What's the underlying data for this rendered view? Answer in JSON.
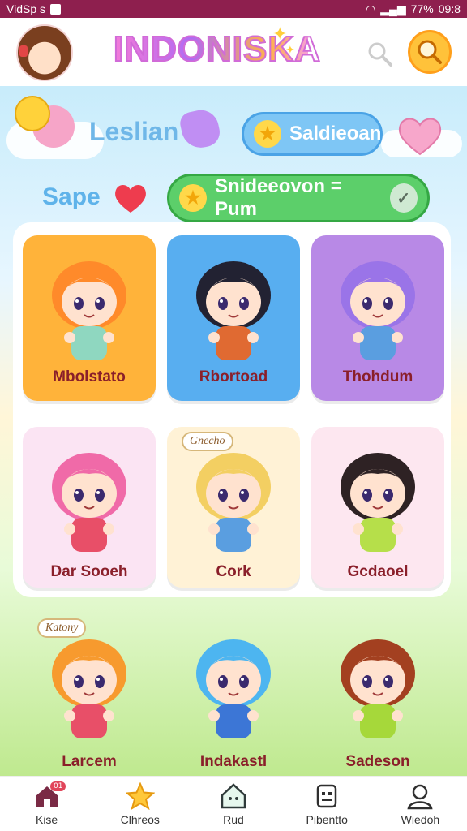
{
  "status_bar": {
    "left_text": "VidSp s",
    "battery": "77%",
    "time": "09:8"
  },
  "app": {
    "title": "INDONISKA"
  },
  "filters": {
    "legend_label": "Leslian",
    "pill_1": "Saldieoan",
    "save_label": "Sape",
    "pill_2": "Snideeovon = Pum"
  },
  "characters": [
    {
      "name": "Mbolstato",
      "bg": "#ffb33a",
      "hair": "#ff8a2a",
      "shirt": "#8fd7c0"
    },
    {
      "name": "Rbortoad",
      "bg": "#58aef0",
      "hair": "#222232",
      "shirt": "#e06a32"
    },
    {
      "name": "Thohdum",
      "bg": "#b889e6",
      "hair": "#9a74e8",
      "shirt": "#5a9ee0"
    },
    {
      "name": "Dar Sooeh",
      "bg": "#fbe4f3",
      "hair": "#f06aa8",
      "shirt": "#e84f68"
    },
    {
      "name": "Cork",
      "bg": "#fff2d6",
      "hair": "#f3cf62",
      "shirt": "#5a9ee0",
      "bubble": "Gnecho"
    },
    {
      "name": "Gcdaoel",
      "bg": "#fde7f0",
      "hair": "#2e2224",
      "shirt": "#b6df4a"
    },
    {
      "name": "Larcem",
      "bg": "transparent",
      "hair": "#f79a2e",
      "shirt": "#e84f68",
      "bubble": "Katony"
    },
    {
      "name": "Indakastl",
      "bg": "transparent",
      "hair": "#4db5f0",
      "shirt": "#3c76d6"
    },
    {
      "name": "Sadeson",
      "bg": "transparent",
      "hair": "#a34020",
      "shirt": "#a6d83a"
    }
  ],
  "tabs": [
    {
      "label": "Kise",
      "icon": "home-icon",
      "badge": "01"
    },
    {
      "label": "Clhreos",
      "icon": "star-icon"
    },
    {
      "label": "Rud",
      "icon": "house-icon"
    },
    {
      "label": "Pibentto",
      "icon": "robot-icon"
    },
    {
      "label": "Wiedoh",
      "icon": "user-icon"
    }
  ]
}
